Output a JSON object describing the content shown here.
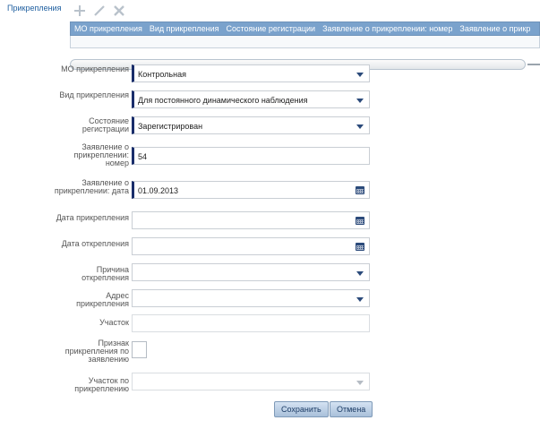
{
  "panel": {
    "title": "Прикрепления"
  },
  "toolbar": {
    "items": [
      {
        "name": "add-icon"
      },
      {
        "name": "edit-icon"
      },
      {
        "name": "delete-icon"
      }
    ]
  },
  "grid": {
    "columns": [
      "МО прикрепления",
      "Вид прикрепления",
      "Состояние регистрации",
      "Заявление о прикреплении: номер",
      "Заявление о прикр"
    ]
  },
  "form": {
    "mo": {
      "label": "МО прикрепления",
      "value": "Контрольная"
    },
    "kind": {
      "label": "Вид прикрепления",
      "value": "Для постоянного динамического наблюдения"
    },
    "state": {
      "label": "Состояние регистрации",
      "value": "Зарегистрирован"
    },
    "app_number": {
      "label": "Заявление о прикреплении: номер",
      "value": "54"
    },
    "app_date": {
      "label": "Заявление о прикреплении: дата",
      "value": "01.09.2013"
    },
    "attach_date": {
      "label": "Дата прикрепления",
      "value": ""
    },
    "detach_date": {
      "label": "Дата открепления",
      "value": ""
    },
    "detach_reason": {
      "label": "Причина открепления",
      "value": ""
    },
    "address": {
      "label": "Адрес прикрепления",
      "value": ""
    },
    "district": {
      "label": "Участок",
      "value": ""
    },
    "by_application": {
      "label": "Признак прикрепления по заявлению",
      "checked": false
    },
    "district_by_attach": {
      "label": "Участок по прикреплению",
      "value": ""
    }
  },
  "buttons": {
    "save": "Сохранить",
    "cancel": "Отмена"
  },
  "colors": {
    "header": "#7aa2cc",
    "required_marker": "#1a2e6b",
    "accent": "#2b4a7a"
  }
}
